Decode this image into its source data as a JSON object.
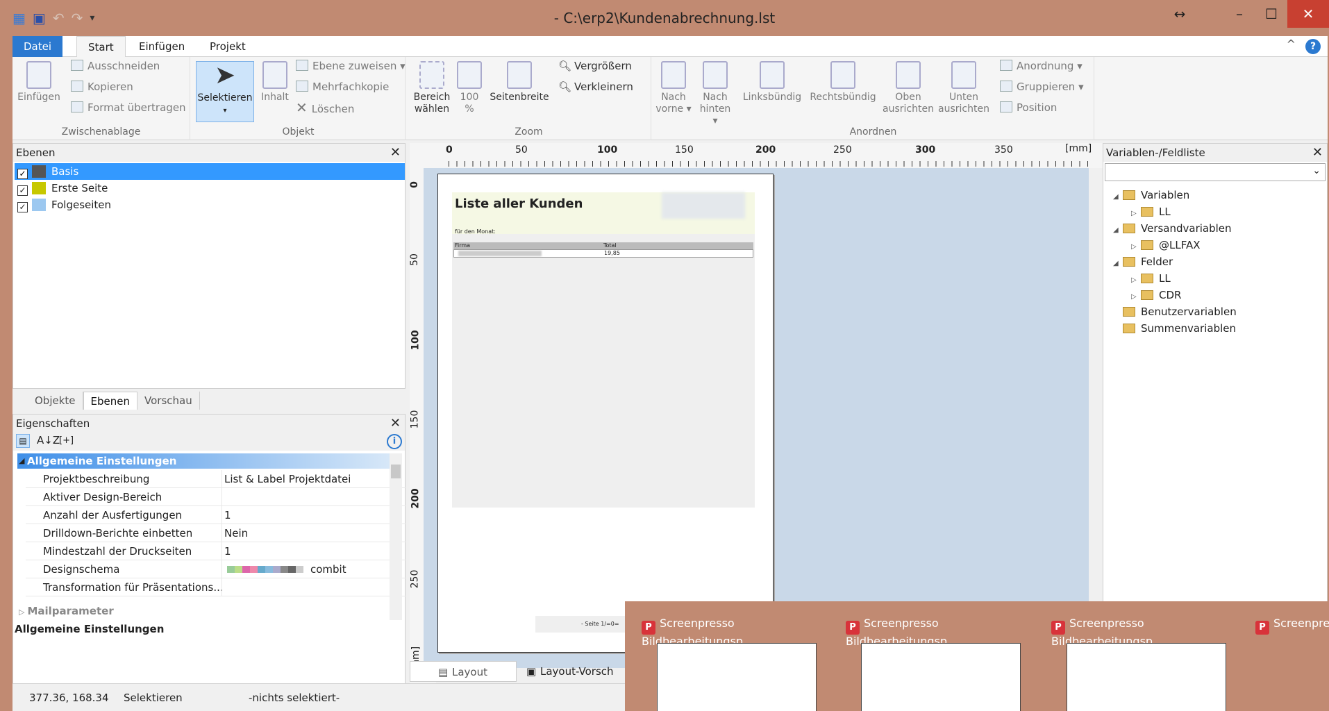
{
  "window": {
    "title": "- C:\\erp2\\Kundenabrechnung.lst"
  },
  "tabs": {
    "datei": "Datei",
    "start": "Start",
    "einfuegen": "Einfügen",
    "projekt": "Projekt"
  },
  "ribbon": {
    "clipboard": {
      "label": "Zwischenablage",
      "paste": "Einfügen",
      "cut": "Ausschneiden",
      "copy": "Kopieren",
      "format": "Format übertragen"
    },
    "object": {
      "label": "Objekt",
      "select": "Selektieren",
      "content": "Inhalt",
      "layer_assign": "Ebene zuweisen",
      "multi_copy": "Mehrfachkopie",
      "delete": "Löschen"
    },
    "zoom": {
      "label": "Zoom",
      "area": "Bereich\nwählen",
      "area1": "Bereich",
      "area2": "wählen",
      "hundred1": "100",
      "hundred2": "%",
      "pagewidth": "Seitenbreite",
      "zoom_in": "Vergrößern",
      "zoom_out": "Verkleinern"
    },
    "arrange": {
      "label": "Anordnen",
      "front1": "Nach",
      "front2": "vorne",
      "back1": "Nach",
      "back2": "hinten",
      "left": "Linksbündig",
      "right": "Rechtsbündig",
      "top1": "Oben",
      "top2": "ausrichten",
      "bottom1": "Unten",
      "bottom2": "ausrichten",
      "order": "Anordnung",
      "group": "Gruppieren",
      "position": "Position"
    }
  },
  "layers": {
    "title": "Ebenen",
    "items": [
      {
        "name": "Basis",
        "color": "#555555"
      },
      {
        "name": "Erste Seite",
        "color": "#c7c800"
      },
      {
        "name": "Folgeseiten",
        "color": "#9cc8f0"
      }
    ],
    "tabs": [
      "Objekte",
      "Ebenen",
      "Vorschau"
    ]
  },
  "properties": {
    "title": "Eigenschaften",
    "section": "Allgemeine Einstellungen",
    "rows": [
      {
        "k": "Projektbeschreibung",
        "v": "List & Label Projektdatei"
      },
      {
        "k": "Aktiver Design-Bereich",
        "v": ""
      },
      {
        "k": "Anzahl der Ausfertigungen",
        "v": "1"
      },
      {
        "k": "Drilldown-Berichte einbetten",
        "v": "Nein"
      },
      {
        "k": "Mindestzahl der Druckseiten",
        "v": "1"
      },
      {
        "k": "Designschema",
        "v": "combit"
      },
      {
        "k": "Transformation für Präsentations...",
        "v": ""
      }
    ],
    "collapsed": "Mailparameter",
    "description": "Allgemeine Einstellungen"
  },
  "ruler": {
    "marks": [
      "0",
      "50",
      "100",
      "150",
      "200",
      "250",
      "300",
      "350",
      "[mm]"
    ],
    "vmarks": [
      "0",
      "50",
      "100",
      "150",
      "200",
      "250",
      "[mm]"
    ]
  },
  "page": {
    "heading": "Liste aller Kunden",
    "sub": "für den Monat:",
    "col1": "Firma",
    "col2": "Total",
    "val": "19,85",
    "footer": "- Seite 1/=0="
  },
  "bottomtabs": {
    "layout": "Layout",
    "preview": "Layout-Vorsch"
  },
  "varlist": {
    "title": "Variablen-/Feldliste",
    "tree": [
      {
        "t": "Variablen",
        "lvl": 0
      },
      {
        "t": "LL",
        "lvl": 1
      },
      {
        "t": "Versandvariablen",
        "lvl": 0
      },
      {
        "t": "@LLFAX",
        "lvl": 1
      },
      {
        "t": "Felder",
        "lvl": 0
      },
      {
        "t": "LL",
        "lvl": 1
      },
      {
        "t": "CDR",
        "lvl": 1
      },
      {
        "t": "Benutzervariablen",
        "lvl": 0
      },
      {
        "t": "Summenvariablen",
        "lvl": 0
      }
    ]
  },
  "status": {
    "coords": "377.36, 168.34",
    "mode": "Selektieren",
    "selection": "-nichts selektiert-"
  },
  "taskbar": {
    "items": [
      "Screenpresso Bildbearbeitungsp...",
      "Screenpresso Bildbearbeitungsp...",
      "Screenpresso Bildbearbeitungsp...",
      "Screenpres"
    ]
  }
}
